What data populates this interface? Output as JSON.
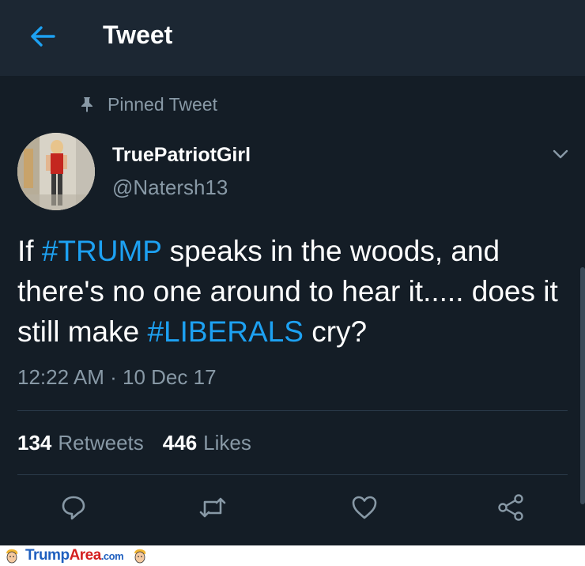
{
  "header": {
    "back_icon": "arrow-left-icon",
    "title": "Tweet",
    "accent_color": "#1da1f2"
  },
  "pinned": {
    "icon": "pin-icon",
    "label": "Pinned Tweet"
  },
  "author": {
    "name": "TruePatriotGirl",
    "handle": "@Natersh13",
    "menu_icon": "chevron-down-icon"
  },
  "tweet": {
    "parts": {
      "p1": "If  ",
      "h1": "#TRUMP",
      "p2": " speaks in the woods,  and there's no one around to hear it..... does it still make ",
      "h2": "#LIBERALS",
      "p3": " cry?"
    },
    "time": "12:22 AM",
    "separator": "·",
    "date": "10 Dec 17"
  },
  "stats": {
    "retweets_count": "134",
    "retweets_label": "Retweets",
    "likes_count": "446",
    "likes_label": "Likes"
  },
  "actions": [
    "reply-icon",
    "retweet-icon",
    "like-icon",
    "share-icon"
  ],
  "watermark": {
    "part1": "Trump",
    "part2": "Area",
    "part3": ".com"
  }
}
